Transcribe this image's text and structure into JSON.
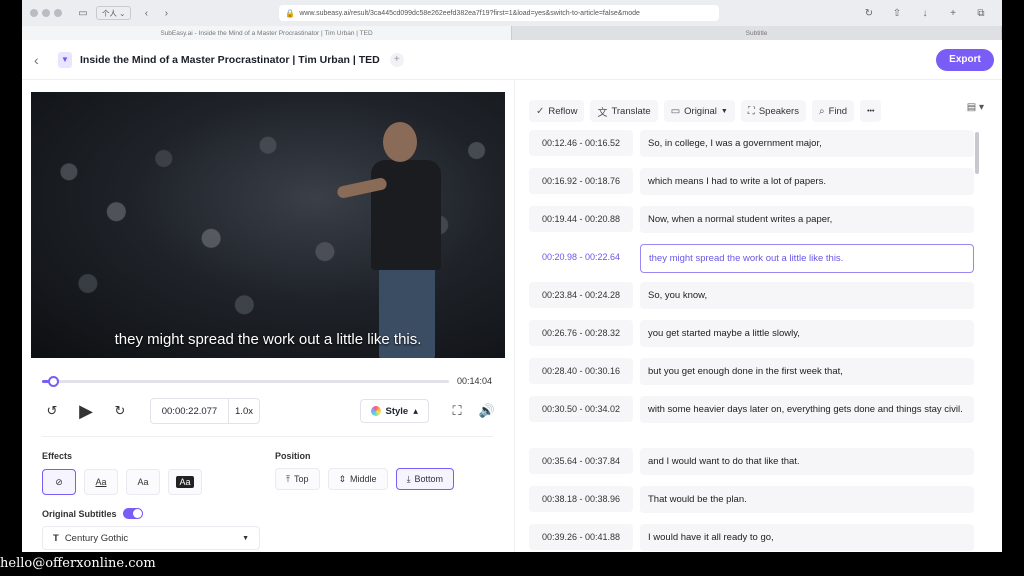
{
  "browser": {
    "profile_label": "个人",
    "url": "www.subeasy.ai/result/3ca445cd099dc58e262eefd382ea7f19?first=1&load=yes&switch-to-article=false&mode",
    "tabs": [
      {
        "label": "SubEasy.ai - Inside the Mind of a Master Procrastinator | Tim Urban | TED"
      },
      {
        "label": "Subtitle"
      }
    ]
  },
  "header": {
    "title": "Inside the Mind of a Master Procrastinator | Tim Urban | TED",
    "export_label": "Export"
  },
  "player": {
    "caption": "they might spread the work out a little like this.",
    "progress_fraction": 0.027,
    "duration": "00:14:04",
    "current_time": "00:00:22.077",
    "speed": "1.0x",
    "style_label": "Style"
  },
  "settings": {
    "effects_label": "Effects",
    "effects": [
      {
        "label": "⊘",
        "name": "none"
      },
      {
        "label": "Aa",
        "name": "outline"
      },
      {
        "label": "Aa",
        "name": "plain"
      },
      {
        "label": "Aa",
        "name": "background"
      }
    ],
    "position_label": "Position",
    "positions": [
      {
        "label": "Top"
      },
      {
        "label": "Middle"
      },
      {
        "label": "Bottom"
      }
    ],
    "original_subtitles_label": "Original Subtitles",
    "font": "Century Gothic"
  },
  "toolbar": {
    "reflow": "Reflow",
    "translate": "Translate",
    "original": "Original",
    "speakers": "Speakers",
    "find": "Find",
    "more": "•••"
  },
  "transcript": [
    {
      "time": "00:12.46  -  00:16.52",
      "text": "So, in college, I was a government major,"
    },
    {
      "time": "00:16.92  -  00:18.76",
      "text": "which means I had to write a lot of papers."
    },
    {
      "time": "00:19.44  -  00:20.88",
      "text": "Now, when a normal student writes a paper,"
    },
    {
      "time": "00:20.98  -  00:22.64",
      "text": "they might spread the work out a little like this."
    },
    {
      "time": "00:23.84  -  00:24.28",
      "text": "So, you know,"
    },
    {
      "time": "00:26.76  -  00:28.32",
      "text": "you get started maybe a little slowly,"
    },
    {
      "time": "00:28.40  -  00:30.16",
      "text": "but you get enough done in the first week that,"
    },
    {
      "time": "00:30.50  -  00:34.02",
      "text": "with some heavier days later on, everything gets done and things stay civil."
    },
    {
      "time": "00:35.64  -  00:37.84",
      "text": "and I would want to do that like that."
    },
    {
      "time": "00:38.18  -  00:38.96",
      "text": "That would be the plan."
    },
    {
      "time": "00:39.26  -  00:41.88",
      "text": "I would have it all ready to go,"
    }
  ],
  "footer": "hello@offerxonline.com"
}
